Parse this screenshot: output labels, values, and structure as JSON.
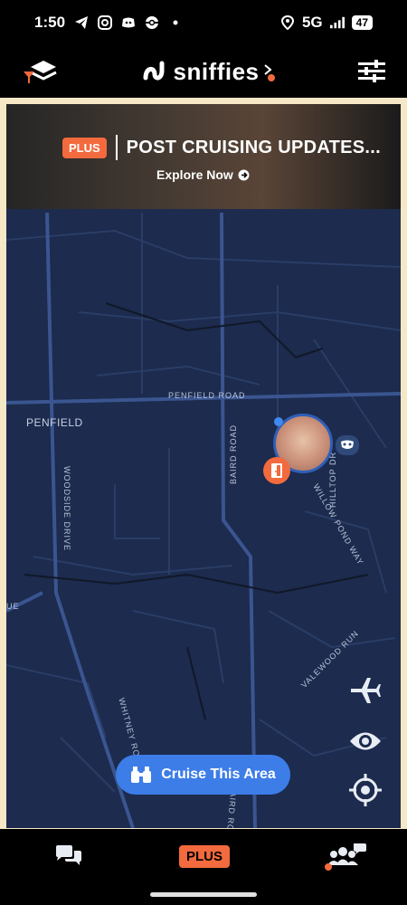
{
  "status_bar": {
    "time": "1:50",
    "network": "5G",
    "battery": "47"
  },
  "header": {
    "app_name": "sniffies"
  },
  "banner": {
    "badge": "PLUS",
    "title": "POST CRUISING UPDATES...",
    "cta": "Explore Now"
  },
  "map": {
    "place": "PENFIELD",
    "roads": [
      "PENFIELD ROAD",
      "WOODSIDE DRIVE",
      "BAIRD ROAD",
      "HILLTOP DR",
      "WILLOW POND WAY",
      "VALEWOOD RUN",
      "WHITNEY RO",
      "UE",
      "AIRD RO"
    ]
  },
  "cruise_button": {
    "label": "Cruise This Area"
  },
  "bottom_nav": {
    "plus_label": "PLUS"
  },
  "colors": {
    "accent": "#f26a3d",
    "map_bg": "#1c2b4e",
    "button_blue": "#3d7de8",
    "frame": "#f6e7c6"
  }
}
